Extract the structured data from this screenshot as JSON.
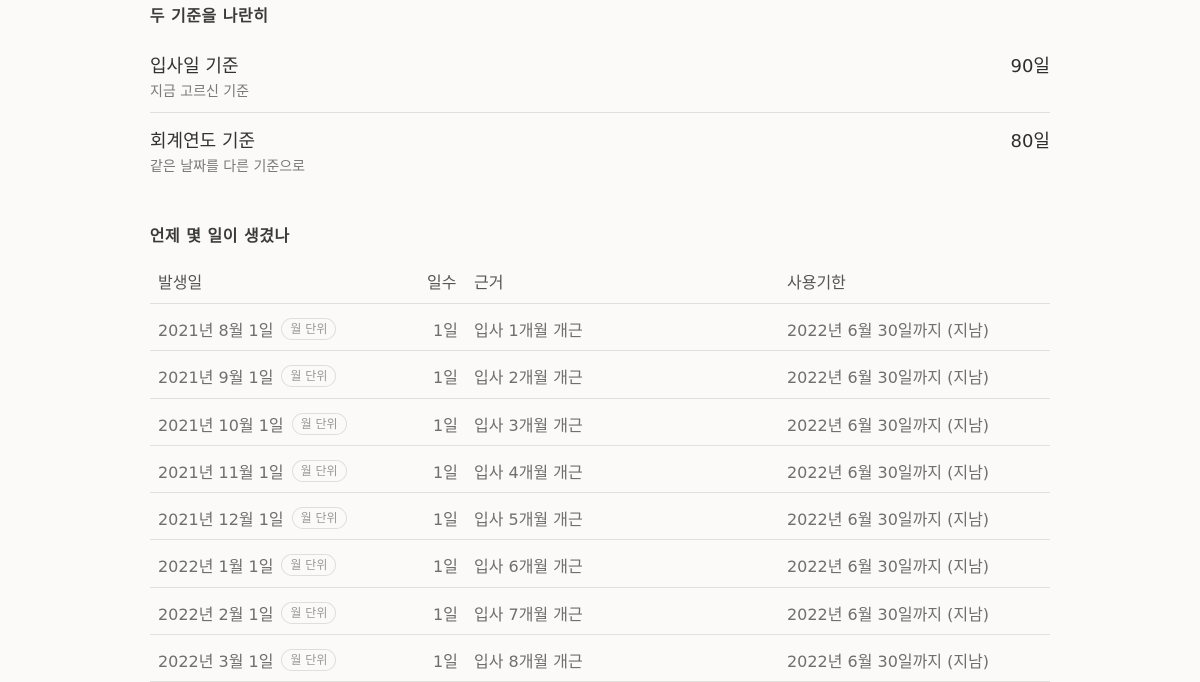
{
  "compare": {
    "title": "두 기준을 나란히",
    "rows": [
      {
        "name": "입사일 기준",
        "sub": "지금 고르신 기준",
        "value": "90일"
      },
      {
        "name": "회계연도 기준",
        "sub": "같은 날짜를 다른 기준으로",
        "value": "80일"
      }
    ]
  },
  "events": {
    "title": "언제 몇 일이 생겼나",
    "headers": {
      "date": "발생일",
      "days": "일수",
      "basis": "근거",
      "expiry": "사용기한"
    },
    "rows": [
      {
        "date": "2021년 8월 1일",
        "badge": "월 단위",
        "days": "1일",
        "basis": "입사 1개월 개근",
        "expiry": "2022년 6월 30일까지 (지남)"
      },
      {
        "date": "2021년 9월 1일",
        "badge": "월 단위",
        "days": "1일",
        "basis": "입사 2개월 개근",
        "expiry": "2022년 6월 30일까지 (지남)"
      },
      {
        "date": "2021년 10월 1일",
        "badge": "월 단위",
        "days": "1일",
        "basis": "입사 3개월 개근",
        "expiry": "2022년 6월 30일까지 (지남)"
      },
      {
        "date": "2021년 11월 1일",
        "badge": "월 단위",
        "days": "1일",
        "basis": "입사 4개월 개근",
        "expiry": "2022년 6월 30일까지 (지남)"
      },
      {
        "date": "2021년 12월 1일",
        "badge": "월 단위",
        "days": "1일",
        "basis": "입사 5개월 개근",
        "expiry": "2022년 6월 30일까지 (지남)"
      },
      {
        "date": "2022년 1월 1일",
        "badge": "월 단위",
        "days": "1일",
        "basis": "입사 6개월 개근",
        "expiry": "2022년 6월 30일까지 (지남)"
      },
      {
        "date": "2022년 2월 1일",
        "badge": "월 단위",
        "days": "1일",
        "basis": "입사 7개월 개근",
        "expiry": "2022년 6월 30일까지 (지남)"
      },
      {
        "date": "2022년 3월 1일",
        "badge": "월 단위",
        "days": "1일",
        "basis": "입사 8개월 개근",
        "expiry": "2022년 6월 30일까지 (지남)"
      }
    ]
  }
}
